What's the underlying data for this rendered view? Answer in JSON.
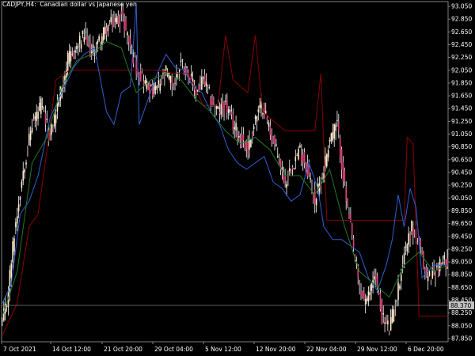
{
  "chart_window": {
    "symbol": "CADJPY,",
    "timeframe": "H4:",
    "description": "Canadian dollar vs Japanese yen"
  },
  "chart_data": {
    "type": "candlestick",
    "x": [
      "7 Oct 2021",
      "14 Oct 12:00",
      "21 Oct 20:00",
      "29 Oct 04:00",
      "5 Nov 12:00",
      "12 Nov 20:00",
      "22 Nov 04:00",
      "29 Nov 12:00",
      "6 Dec 20:00"
    ],
    "price_ticks": [
      "93.050",
      "92.850",
      "92.650",
      "92.450",
      "92.250",
      "92.050",
      "91.850",
      "91.650",
      "91.450",
      "91.250",
      "91.050",
      "90.850",
      "90.650",
      "90.450",
      "90.250",
      "90.050",
      "89.850",
      "89.650",
      "89.450",
      "89.250",
      "89.050",
      "88.850",
      "88.650",
      "88.450",
      "88.250",
      "88.050",
      "87.850"
    ],
    "ylim": [
      87.8,
      93.1
    ],
    "current_price": "88.370",
    "close_path": [
      [
        0,
        88.1
      ],
      [
        3,
        88.4
      ],
      [
        8,
        89.5
      ],
      [
        14,
        90.5
      ],
      [
        20,
        91.2
      ],
      [
        26,
        91.5
      ],
      [
        32,
        91.0
      ],
      [
        38,
        91.6
      ],
      [
        44,
        92.2
      ],
      [
        50,
        92.4
      ],
      [
        55,
        92.6
      ],
      [
        60,
        92.3
      ],
      [
        65,
        92.5
      ],
      [
        70,
        92.7
      ],
      [
        75,
        92.8
      ],
      [
        80,
        92.9
      ],
      [
        84,
        92.6
      ],
      [
        90,
        92.1
      ],
      [
        95,
        91.9
      ],
      [
        100,
        91.7
      ],
      [
        105,
        91.8
      ],
      [
        110,
        92.0
      ],
      [
        115,
        91.8
      ],
      [
        120,
        92.2
      ],
      [
        125,
        92.0
      ],
      [
        130,
        91.7
      ],
      [
        135,
        91.9
      ],
      [
        140,
        91.6
      ],
      [
        145,
        91.4
      ],
      [
        150,
        91.5
      ],
      [
        155,
        91.2
      ],
      [
        160,
        91.0
      ],
      [
        165,
        90.8
      ],
      [
        170,
        91.3
      ],
      [
        175,
        91.5
      ],
      [
        180,
        91.1
      ],
      [
        185,
        90.7
      ],
      [
        190,
        90.3
      ],
      [
        195,
        90.6
      ],
      [
        200,
        90.8
      ],
      [
        205,
        90.5
      ],
      [
        210,
        90.0
      ],
      [
        215,
        90.4
      ],
      [
        220,
        91.0
      ],
      [
        225,
        91.2
      ],
      [
        230,
        90.2
      ],
      [
        235,
        89.4
      ],
      [
        240,
        88.6
      ],
      [
        245,
        88.4
      ],
      [
        250,
        88.9
      ],
      [
        255,
        88.2
      ],
      [
        260,
        88.0
      ],
      [
        265,
        88.5
      ],
      [
        270,
        89.2
      ],
      [
        275,
        89.6
      ],
      [
        280,
        89.3
      ],
      [
        285,
        88.8
      ],
      [
        290,
        88.9
      ],
      [
        299,
        89.1
      ]
    ],
    "series": [
      {
        "name": "",
        "color": "#8b0000",
        "values": [
          [
            0,
            87.9
          ],
          [
            10,
            88.4
          ],
          [
            18,
            89.6
          ],
          [
            24,
            89.8
          ],
          [
            30,
            90.8
          ],
          [
            36,
            91.9
          ],
          [
            45,
            92.05
          ],
          [
            55,
            92.05
          ],
          [
            65,
            92.05
          ],
          [
            75,
            92.05
          ],
          [
            85,
            92.05
          ],
          [
            95,
            92.05
          ],
          [
            105,
            92.05
          ],
          [
            115,
            92.0
          ],
          [
            125,
            92.0
          ],
          [
            135,
            91.5
          ],
          [
            145,
            91.5
          ],
          [
            150,
            92.6
          ],
          [
            155,
            91.9
          ],
          [
            160,
            91.8
          ],
          [
            165,
            91.7
          ],
          [
            170,
            92.6
          ],
          [
            175,
            91.4
          ],
          [
            180,
            91.3
          ],
          [
            185,
            91.2
          ],
          [
            190,
            91.1
          ],
          [
            200,
            91.1
          ],
          [
            210,
            91.1
          ],
          [
            214,
            92.0
          ],
          [
            218,
            89.7
          ],
          [
            230,
            89.7
          ],
          [
            245,
            89.7
          ],
          [
            260,
            89.7
          ],
          [
            270,
            89.7
          ],
          [
            272,
            91.0
          ],
          [
            276,
            90.9
          ],
          [
            280,
            88.2
          ],
          [
            290,
            88.2
          ],
          [
            299,
            88.2
          ]
        ]
      },
      {
        "name": "",
        "color": "#2f5fd0",
        "values": [
          [
            0,
            88.4
          ],
          [
            6,
            88.7
          ],
          [
            12,
            89.8
          ],
          [
            18,
            90.0
          ],
          [
            24,
            90.4
          ],
          [
            32,
            91.3
          ],
          [
            40,
            91.7
          ],
          [
            48,
            92.1
          ],
          [
            55,
            92.3
          ],
          [
            62,
            92.4
          ],
          [
            70,
            91.4
          ],
          [
            75,
            91.2
          ],
          [
            80,
            91.7
          ],
          [
            86,
            91.8
          ],
          [
            90,
            93.1
          ],
          [
            92,
            91.2
          ],
          [
            98,
            91.6
          ],
          [
            104,
            92.0
          ],
          [
            110,
            92.3
          ],
          [
            116,
            92.1
          ],
          [
            122,
            92.05
          ],
          [
            128,
            91.8
          ],
          [
            134,
            91.7
          ],
          [
            140,
            91.4
          ],
          [
            146,
            91.2
          ],
          [
            152,
            90.8
          ],
          [
            158,
            90.6
          ],
          [
            164,
            90.5
          ],
          [
            170,
            90.6
          ],
          [
            176,
            90.7
          ],
          [
            182,
            90.3
          ],
          [
            188,
            90.2
          ],
          [
            194,
            90.0
          ],
          [
            200,
            90.1
          ],
          [
            206,
            90.6
          ],
          [
            212,
            90.2
          ],
          [
            216,
            89.6
          ],
          [
            222,
            89.4
          ],
          [
            228,
            89.4
          ],
          [
            234,
            89.3
          ],
          [
            240,
            89.2
          ],
          [
            246,
            88.8
          ],
          [
            252,
            88.6
          ],
          [
            258,
            89.0
          ],
          [
            262,
            89.4
          ],
          [
            266,
            90.1
          ],
          [
            270,
            89.6
          ],
          [
            274,
            90.2
          ],
          [
            278,
            89.9
          ],
          [
            282,
            88.8
          ],
          [
            290,
            89.0
          ],
          [
            299,
            89.0
          ]
        ]
      },
      {
        "name": "",
        "color": "#1f7a1f",
        "values": [
          [
            0,
            88.2
          ],
          [
            10,
            88.9
          ],
          [
            20,
            90.6
          ],
          [
            30,
            91.0
          ],
          [
            40,
            91.8
          ],
          [
            50,
            92.2
          ],
          [
            60,
            92.3
          ],
          [
            70,
            92.5
          ],
          [
            80,
            92.4
          ],
          [
            90,
            91.7
          ],
          [
            100,
            91.9
          ],
          [
            110,
            92.0
          ],
          [
            120,
            91.9
          ],
          [
            130,
            91.6
          ],
          [
            140,
            91.4
          ],
          [
            150,
            91.1
          ],
          [
            160,
            90.9
          ],
          [
            170,
            91.0
          ],
          [
            180,
            90.8
          ],
          [
            190,
            90.4
          ],
          [
            200,
            90.4
          ],
          [
            210,
            90.1
          ],
          [
            220,
            90.5
          ],
          [
            230,
            89.6
          ],
          [
            240,
            88.9
          ],
          [
            250,
            88.7
          ],
          [
            260,
            88.5
          ],
          [
            270,
            89.0
          ],
          [
            280,
            89.2
          ],
          [
            290,
            88.9
          ],
          [
            299,
            89.0
          ]
        ]
      }
    ]
  }
}
